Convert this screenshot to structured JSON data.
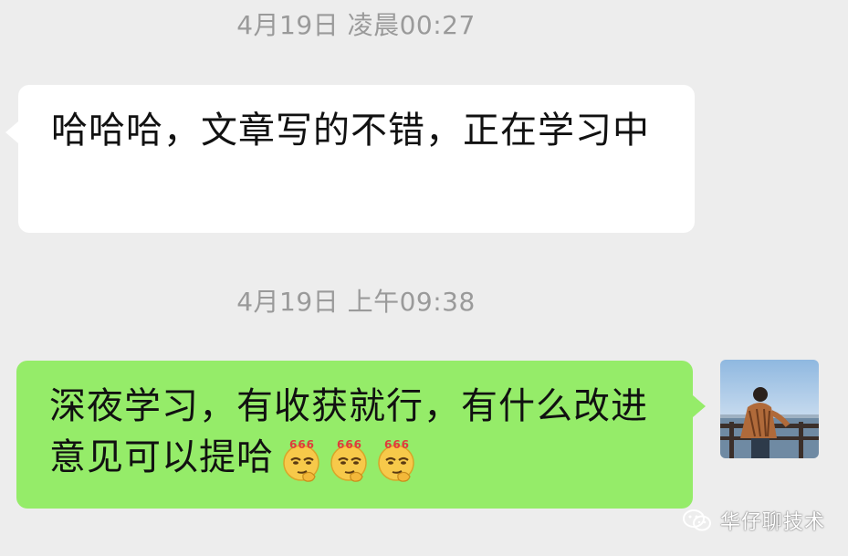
{
  "messages": [
    {
      "timestamp": "4月19日 凌晨00:27",
      "direction": "incoming",
      "text": "哈哈哈，文章写的不错，正在学习中"
    },
    {
      "timestamp": "4月19日 上午09:38",
      "direction": "outgoing",
      "text": "深夜学习，有收获就行，有什么改进意见可以提哈",
      "emojis": [
        "666-thinking-emoji",
        "666-thinking-emoji",
        "666-thinking-emoji"
      ],
      "emoji_badge": "666"
    }
  ],
  "watermark": {
    "text": "华仔聊技术",
    "icon": "wechat-official-account-icon"
  },
  "colors": {
    "background": "#ededed",
    "incoming_bubble": "#ffffff",
    "outgoing_bubble": "#95ec69",
    "timestamp_text": "#9a9a9a"
  }
}
